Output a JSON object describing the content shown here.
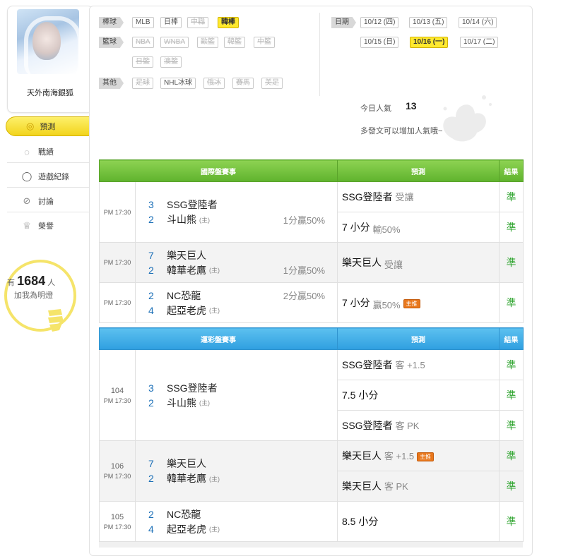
{
  "profile": {
    "username": "天外南海銀狐"
  },
  "sidebar": {
    "items": [
      {
        "label": "預測",
        "icon": "target-icon"
      },
      {
        "label": "戰績",
        "icon": "chat-icon"
      },
      {
        "label": "遊戲紀錄",
        "icon": "ring-icon"
      },
      {
        "label": "討論",
        "icon": "search-icon"
      },
      {
        "label": "榮譽",
        "icon": "medal-icon"
      }
    ],
    "fans": {
      "prefix": "有",
      "count": "1684",
      "unit": "人",
      "sub": "加我為明燈"
    }
  },
  "categories": {
    "baseball": {
      "label": "棒球",
      "tags": [
        "MLB",
        "日棒",
        "中職",
        "韓棒"
      ]
    },
    "basketball": {
      "label": "籃球",
      "tags": [
        "NBA",
        "WNBA",
        "歐籃",
        "韓籃",
        "中籃",
        "日籃",
        "澳籃"
      ]
    },
    "other": {
      "label": "其他",
      "tags": [
        "足球",
        "NHL冰球",
        "俄冰",
        "賽馬",
        "美足"
      ]
    }
  },
  "dates": {
    "label": "日期",
    "items": [
      "10/12 (四)",
      "10/13 (五)",
      "10/14 (六)",
      "10/15 (日)",
      "10/16 (一)",
      "10/17 (二)"
    ],
    "selected": "10/16 (一)"
  },
  "popularity": {
    "label": "今日人氣",
    "value": "13",
    "sub": "多發文可以增加人氣哦~"
  },
  "intl": {
    "header": "國際盤賽事",
    "pred_header": "預測",
    "result_header": "結果",
    "rows": [
      {
        "time": "PM 17:30",
        "t1": "SSG登陸者",
        "s1": "3",
        "t2": "斗山熊",
        "s2": "2",
        "host": "(主)",
        "hcp": "1分贏50%",
        "hcp_row": 2,
        "preds": [
          {
            "main": "SSG登陸者",
            "sub": "受讓",
            "res": "準"
          },
          {
            "main": "7 小分",
            "sub": "輸50%",
            "res": "準"
          }
        ]
      },
      {
        "time": "PM 17:30",
        "t1": "樂天巨人",
        "s1": "7",
        "t2": "韓華老鷹",
        "s2": "2",
        "host": "(主)",
        "hcp": "1分贏50%",
        "hcp_row": 2,
        "preds": [
          {
            "main": "樂天巨人",
            "sub": "受讓",
            "res": "準"
          }
        ]
      },
      {
        "time": "PM 17:30",
        "t1": "NC恐龍",
        "s1": "2",
        "t2": "起亞老虎",
        "s2": "4",
        "host": "(主)",
        "hcp": "2分贏50%",
        "hcp_row": 1,
        "preds": [
          {
            "main": "7 小分",
            "sub": "贏50%",
            "res": "準",
            "badge": "主推"
          }
        ]
      }
    ]
  },
  "lottery": {
    "header": "運彩盤賽事",
    "pred_header": "預測",
    "result_header": "結果",
    "rows": [
      {
        "no": "104",
        "time": "PM 17:30",
        "t1": "SSG登陸者",
        "s1": "3",
        "t2": "斗山熊",
        "s2": "2",
        "host": "(主)",
        "preds": [
          {
            "main": "SSG登陸者",
            "sub": "客 +1.5",
            "res": "準"
          },
          {
            "main": "7.5 小分",
            "sub": "",
            "res": "準"
          },
          {
            "main": "SSG登陸者",
            "sub": "客 PK",
            "res": "準"
          }
        ]
      },
      {
        "no": "106",
        "time": "PM 17:30",
        "t1": "樂天巨人",
        "s1": "7",
        "t2": "韓華老鷹",
        "s2": "2",
        "host": "(主)",
        "preds": [
          {
            "main": "樂天巨人",
            "sub": "客 +1.5",
            "res": "準",
            "badge": "主推"
          },
          {
            "main": "樂天巨人",
            "sub": "客 PK",
            "res": "準"
          }
        ]
      },
      {
        "no": "105",
        "time": "PM 17:30",
        "t1": "NC恐龍",
        "s1": "2",
        "t2": "起亞老虎",
        "s2": "4",
        "host": "(主)",
        "preds": [
          {
            "main": "8.5 小分",
            "sub": "",
            "res": "準"
          }
        ]
      }
    ]
  },
  "colors": {
    "accent_yellow": "#f2d41c",
    "green_header": "#6cbf38",
    "blue_header": "#3aa6e4",
    "result_green": "#2fa52f",
    "score_blue": "#1b6fb7"
  }
}
